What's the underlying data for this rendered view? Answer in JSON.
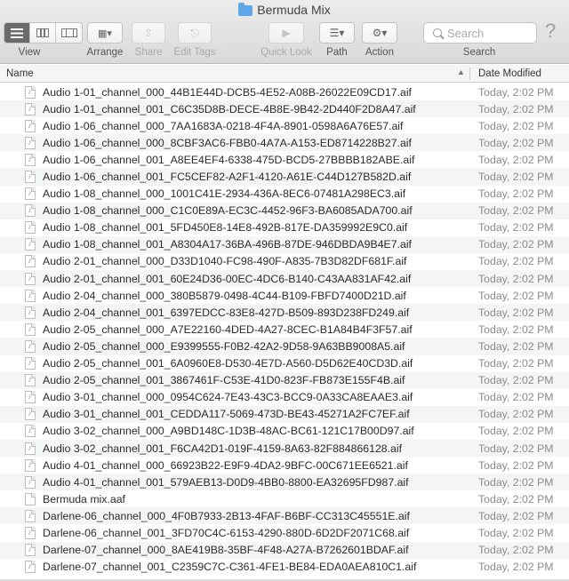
{
  "window": {
    "title": "Bermuda Mix"
  },
  "toolbar": {
    "view_label": "View",
    "arrange_label": "Arrange",
    "share_label": "Share",
    "edit_tags_label": "Edit Tags",
    "quick_look_label": "Quick Look",
    "path_label": "Path",
    "action_label": "Action",
    "search_label": "Search",
    "search_placeholder": "Search"
  },
  "columns": {
    "name": "Name",
    "date_modified": "Date Modified"
  },
  "files": [
    {
      "name": "Audio 1-01_channel_000_44B1E44D-DCB5-4E52-A08B-26022E09CD17.aif",
      "date": "Today, 2:02 PM",
      "icon": "audio"
    },
    {
      "name": "Audio 1-01_channel_001_C6C35D8B-DECE-4B8E-9B42-2D440F2D8A47.aif",
      "date": "Today, 2:02 PM",
      "icon": "audio"
    },
    {
      "name": "Audio 1-06_channel_000_7AA1683A-0218-4F4A-8901-0598A6A76E57.aif",
      "date": "Today, 2:02 PM",
      "icon": "audio"
    },
    {
      "name": "Audio 1-06_channel_000_8CBF3AC6-FBB0-4A7A-A153-ED8714228B27.aif",
      "date": "Today, 2:02 PM",
      "icon": "audio"
    },
    {
      "name": "Audio 1-06_channel_001_A8EE4EF4-6338-475D-BCD5-27BBBB182ABE.aif",
      "date": "Today, 2:02 PM",
      "icon": "audio"
    },
    {
      "name": "Audio 1-06_channel_001_FC5CEF82-A2F1-4120-A61E-C44D127B582D.aif",
      "date": "Today, 2:02 PM",
      "icon": "audio"
    },
    {
      "name": "Audio 1-08_channel_000_1001C41E-2934-436A-8EC6-07481A298EC3.aif",
      "date": "Today, 2:02 PM",
      "icon": "audio"
    },
    {
      "name": "Audio 1-08_channel_000_C1C0E89A-EC3C-4452-96F3-BA6085ADA700.aif",
      "date": "Today, 2:02 PM",
      "icon": "audio"
    },
    {
      "name": "Audio 1-08_channel_001_5FD450E8-14E8-492B-817E-DA359992E9C0.aif",
      "date": "Today, 2:02 PM",
      "icon": "audio"
    },
    {
      "name": "Audio 1-08_channel_001_A8304A17-36BA-496B-87DE-946DBDA9B4E7.aif",
      "date": "Today, 2:02 PM",
      "icon": "audio"
    },
    {
      "name": "Audio 2-01_channel_000_D33D1040-FC98-490F-A835-7B3D82DF681F.aif",
      "date": "Today, 2:02 PM",
      "icon": "audio"
    },
    {
      "name": "Audio 2-01_channel_001_60E24D36-00EC-4DC6-B140-C43AA831AF42.aif",
      "date": "Today, 2:02 PM",
      "icon": "audio"
    },
    {
      "name": "Audio 2-04_channel_000_380B5879-0498-4C44-B109-FBFD7400D21D.aif",
      "date": "Today, 2:02 PM",
      "icon": "audio"
    },
    {
      "name": "Audio 2-04_channel_001_6397EDCC-83E8-427D-B509-893D238FD249.aif",
      "date": "Today, 2:02 PM",
      "icon": "audio"
    },
    {
      "name": "Audio 2-05_channel_000_A7E22160-4DED-4A27-8CEC-B1A84B4F3F57.aif",
      "date": "Today, 2:02 PM",
      "icon": "audio"
    },
    {
      "name": "Audio 2-05_channel_000_E9399555-F0B2-42A2-9D58-9A63BB9008A5.aif",
      "date": "Today, 2:02 PM",
      "icon": "audio"
    },
    {
      "name": "Audio 2-05_channel_001_6A0960E8-D530-4E7D-A560-D5D62E40CD3D.aif",
      "date": "Today, 2:02 PM",
      "icon": "audio"
    },
    {
      "name": "Audio 2-05_channel_001_3867461F-C53E-41D0-823F-FB873E155F4B.aif",
      "date": "Today, 2:02 PM",
      "icon": "audio"
    },
    {
      "name": "Audio 3-01_channel_000_0954C624-7E43-43C3-BCC9-0A33CA8EAAE3.aif",
      "date": "Today, 2:02 PM",
      "icon": "audio"
    },
    {
      "name": "Audio 3-01_channel_001_CEDDA117-5069-473D-BE43-45271A2FC7EF.aif",
      "date": "Today, 2:02 PM",
      "icon": "audio"
    },
    {
      "name": "Audio 3-02_channel_000_A9BD148C-1D3B-48AC-BC61-121C17B00D97.aif",
      "date": "Today, 2:02 PM",
      "icon": "audio"
    },
    {
      "name": "Audio 3-02_channel_001_F6CA42D1-019F-4159-8A63-82F884866128.aif",
      "date": "Today, 2:02 PM",
      "icon": "audio"
    },
    {
      "name": "Audio 4-01_channel_000_66923B22-E9F9-4DA2-9BFC-00C671EE6521.aif",
      "date": "Today, 2:02 PM",
      "icon": "audio"
    },
    {
      "name": "Audio 4-01_channel_001_579AEB13-D0D9-4BB0-8800-EA32695FD987.aif",
      "date": "Today, 2:02 PM",
      "icon": "audio"
    },
    {
      "name": "Bermuda mix.aaf",
      "date": "Today, 2:02 PM",
      "icon": "document"
    },
    {
      "name": "Darlene-06_channel_000_4F0B7933-2B13-4FAF-B6BF-CC313C45551E.aif",
      "date": "Today, 2:02 PM",
      "icon": "audio"
    },
    {
      "name": "Darlene-06_channel_001_3FD70C4C-6153-4290-880D-6D2DF2071C68.aif",
      "date": "Today, 2:02 PM",
      "icon": "audio"
    },
    {
      "name": "Darlene-07_channel_000_8AE419B8-35BF-4F48-A27A-B7262601BDAF.aif",
      "date": "Today, 2:02 PM",
      "icon": "audio"
    },
    {
      "name": "Darlene-07_channel_001_C2359C7C-C361-4FE1-BE84-EDA0AEA810C1.aif",
      "date": "Today, 2:02 PM",
      "icon": "audio"
    }
  ]
}
